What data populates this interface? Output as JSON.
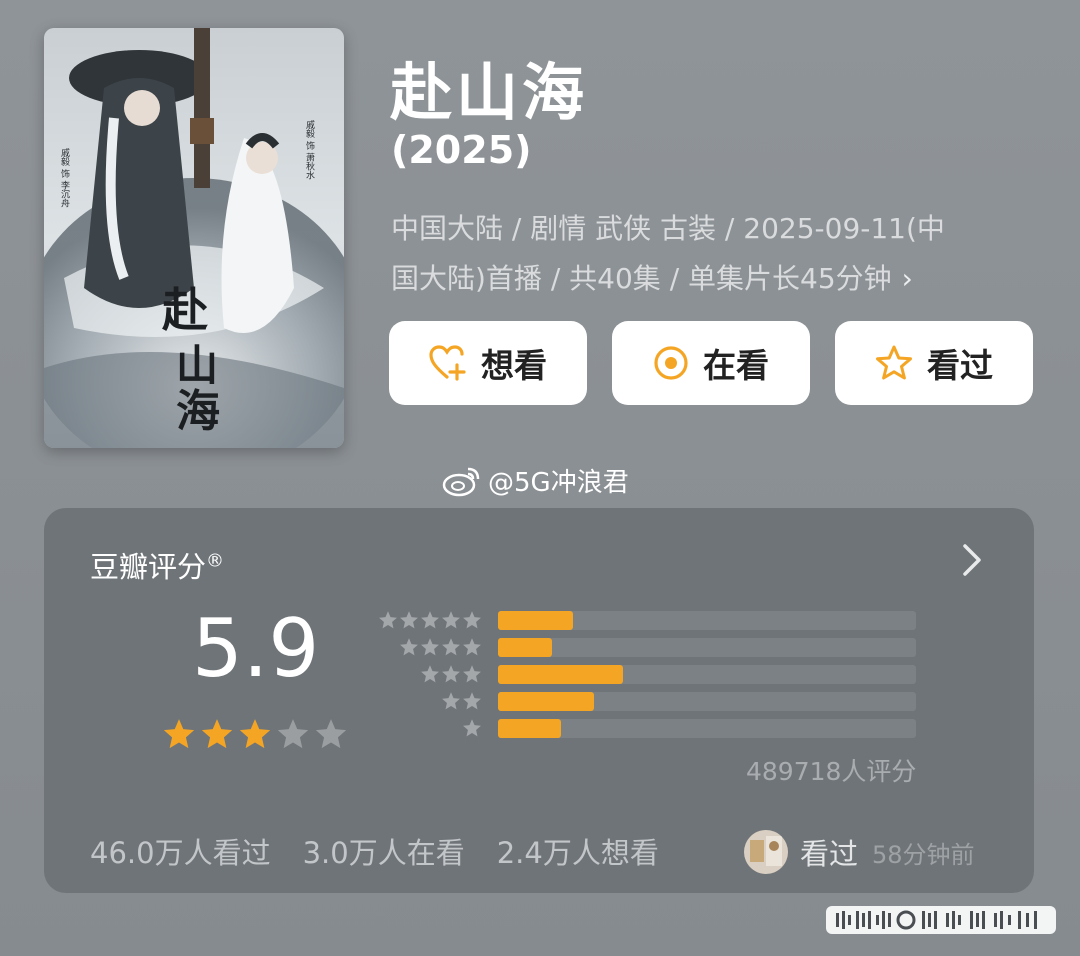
{
  "movie": {
    "title": "赴山海",
    "year": "(2025)",
    "meta_line1": "中国大陆 / 剧情 武侠 古装 / 2025-09-11(中",
    "meta_line2": "国大陆)首播 / 共40集 / 单集片长45分钟",
    "meta_chevron": "›",
    "poster": {
      "calligraphy": "赴山海",
      "credit_left": "戚毅 饰 李沉舟",
      "credit_right": "戚毅 饰 萧秋水"
    }
  },
  "actions": [
    {
      "label": "想看",
      "icon": "heart-plus-icon"
    },
    {
      "label": "在看",
      "icon": "target-circle-icon"
    },
    {
      "label": "看过",
      "icon": "star-outline-icon"
    }
  ],
  "watermark": {
    "text": "@5G冲浪君",
    "icon": "weibo-icon"
  },
  "rating": {
    "section_title": "豆瓣评分",
    "registered_mark": "®",
    "score": "5.9",
    "stars": 3,
    "max_stars": 5,
    "distribution": [
      {
        "stars": 5,
        "fraction": 0.18
      },
      {
        "stars": 4,
        "fraction": 0.13
      },
      {
        "stars": 3,
        "fraction": 0.3
      },
      {
        "stars": 2,
        "fraction": 0.23
      },
      {
        "stars": 1,
        "fraction": 0.15
      }
    ],
    "count_text": "489718人评分"
  },
  "stats": {
    "seen": "46.0万人看过",
    "watching": "3.0万人在看",
    "want": "2.4万人想看"
  },
  "recent": {
    "action": "看过",
    "time": "58分钟前"
  },
  "colors": {
    "accent_star": "#f5a524",
    "button_icon": "#f5a524",
    "card_bg": "#6f7478"
  }
}
